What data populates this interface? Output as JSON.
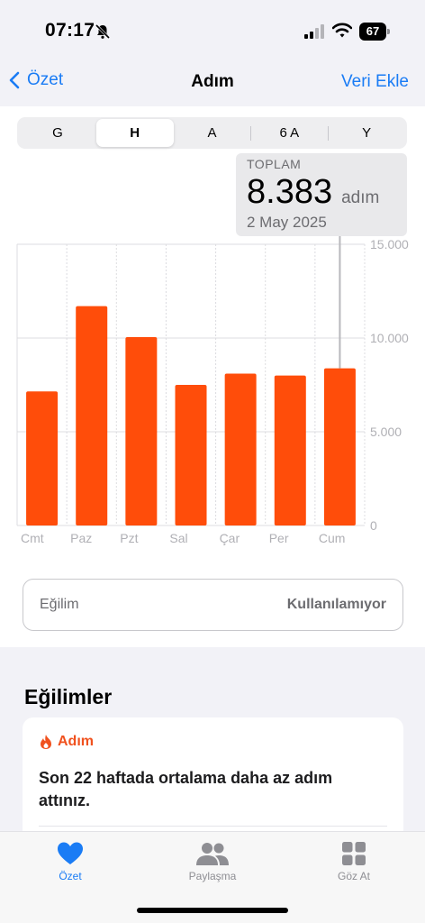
{
  "status": {
    "time": "07:17",
    "battery": "67"
  },
  "nav": {
    "back_label": "Özet",
    "title": "Adım",
    "action_label": "Veri Ekle"
  },
  "segments": [
    {
      "label": "G",
      "active": false
    },
    {
      "label": "H",
      "active": true
    },
    {
      "label": "A",
      "active": false
    },
    {
      "label": "6 A",
      "active": false
    },
    {
      "label": "Y",
      "active": false
    }
  ],
  "tooltip": {
    "label": "TOPLAM",
    "value": "8.383",
    "unit": "adım",
    "date": "2 May 2025"
  },
  "chart_data": {
    "type": "bar",
    "categories": [
      "Cmt",
      "Paz",
      "Pzt",
      "Sal",
      "Çar",
      "Per",
      "Cum"
    ],
    "values": [
      7150,
      11700,
      10050,
      7500,
      8100,
      8000,
      8383
    ],
    "ylim": [
      0,
      15000
    ],
    "ytick_labels": [
      "15.000",
      "10.000",
      "5.000",
      "0"
    ],
    "ytick_values": [
      15000,
      10000,
      5000,
      0
    ],
    "selected_index": 6,
    "grid": true,
    "bar_color": "#ff4d0a"
  },
  "trend": {
    "label": "Eğilim",
    "value": "Kullanılamıyor"
  },
  "trends_section": {
    "title": "Eğilimler",
    "card_heading": "Adım",
    "card_text": "Son 22 haftada ortalama daha az adım attınız."
  },
  "tabs": [
    {
      "label": "Özet",
      "icon": "heart-icon",
      "active": true
    },
    {
      "label": "Paylaşma",
      "icon": "people-icon",
      "active": false
    },
    {
      "label": "Göz At",
      "icon": "grid-icon",
      "active": false
    }
  ],
  "colors": {
    "accent": "#1a7cf5",
    "steps": "#ff4d0a",
    "active_tab": "#1a7cf5",
    "inactive_tab": "#8e8e93"
  }
}
